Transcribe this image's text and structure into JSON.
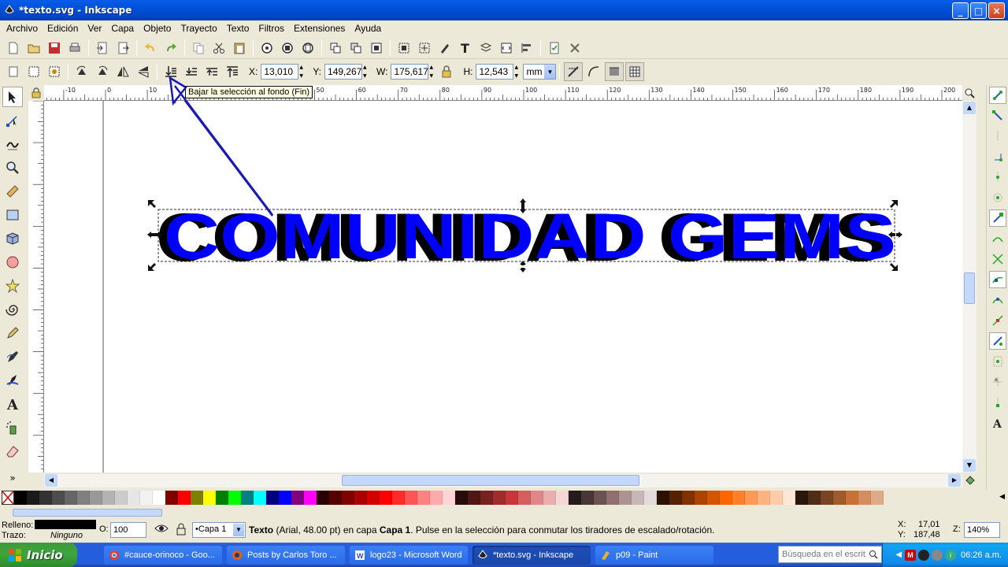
{
  "window": {
    "title": "*texto.svg - Inkscape",
    "controls": [
      "_",
      "□",
      "×"
    ]
  },
  "menu": [
    "Archivo",
    "Edición",
    "Ver",
    "Capa",
    "Objeto",
    "Trayecto",
    "Texto",
    "Filtros",
    "Extensiones",
    "Ayuda"
  ],
  "tool_controls": {
    "x_label": "X:",
    "x_value": "13,010",
    "y_label": "Y:",
    "y_value": "149,267",
    "w_label": "W:",
    "w_value": "175,617",
    "h_label": "H:",
    "h_value": "12,543",
    "unit": "mm"
  },
  "tooltip": "Bajar la selección al fondo (Fin)",
  "ruler_top_labels": [
    "-10",
    "0",
    "10",
    "20",
    "30",
    "40",
    "50",
    "60",
    "70",
    "80",
    "90",
    "100",
    "110",
    "120",
    "130",
    "140",
    "150",
    "160",
    "170",
    "180",
    "190",
    "200"
  ],
  "canvas_text": "COMUNIDAD GEMS",
  "colors": {
    "text_fill": "#0000ff",
    "text_shadow": "#000000",
    "arrow": "#1a1ab0",
    "accent": "#0a5ce8"
  },
  "palette": [
    "#000000",
    "#1a1a1a",
    "#333333",
    "#4d4d4d",
    "#666666",
    "#808080",
    "#999999",
    "#b3b3b3",
    "#cccccc",
    "#e6e6e6",
    "#f2f2f2",
    "#ffffff",
    "#800000",
    "#ff0000",
    "#808000",
    "#ffff00",
    "#008000",
    "#00ff00",
    "#008080",
    "#00ffff",
    "#000080",
    "#0000ff",
    "#800080",
    "#ff00ff",
    "#2b0000",
    "#550000",
    "#800000",
    "#aa0000",
    "#d40000",
    "#ff0000",
    "#ff2a2a",
    "#ff5555",
    "#ff8080",
    "#ffaaaa",
    "#ffd5d5",
    "#280b0b",
    "#501616",
    "#782121",
    "#a02c2c",
    "#c83737",
    "#d35f5f",
    "#de8787",
    "#e9afaf",
    "#f4d7d7",
    "#241c1c",
    "#483737",
    "#6c5353",
    "#916f6f",
    "#ac9393",
    "#c8b7b7",
    "#e3dbdb",
    "#2b1100",
    "#552200",
    "#803300",
    "#aa4400",
    "#d45500",
    "#ff6600",
    "#ff7f2a",
    "#ff9955",
    "#ffb380",
    "#ffccaa",
    "#ffe6d5",
    "#28170b",
    "#502d16",
    "#784421",
    "#a05a2c",
    "#c87137",
    "#d38d5f",
    "#deaa87"
  ],
  "status": {
    "fill_label": "Relleno:",
    "stroke_label": "Trazo:",
    "stroke_value": "Ninguno",
    "opacity_label": "O:",
    "opacity_value": "100",
    "layer": "•Capa 1",
    "message_bold": "Texto",
    "message_rest": " (Arial, 48.00 pt) en capa ",
    "message_layer": "Capa 1",
    "message_tail": ". Pulse en la selección para conmutar los tiradores de escalado/rotación.",
    "coord_x_label": "X:",
    "coord_x": "17,01",
    "coord_y_label": "Y:",
    "coord_y": "187,48",
    "zoom_label": "Z:",
    "zoom": "140%"
  },
  "taskbar": {
    "start": "Inicio",
    "tasks": [
      {
        "label": "#cauce-orinoco - Goo..."
      },
      {
        "label": "Posts by Carlos Toro ..."
      },
      {
        "label": "logo23 - Microsoft Word"
      },
      {
        "label": "*texto.svg - Inkscape"
      },
      {
        "label": "p09 - Paint"
      }
    ],
    "search_placeholder": "Búsqueda en el escrit",
    "clock": "06:26 a.m."
  }
}
